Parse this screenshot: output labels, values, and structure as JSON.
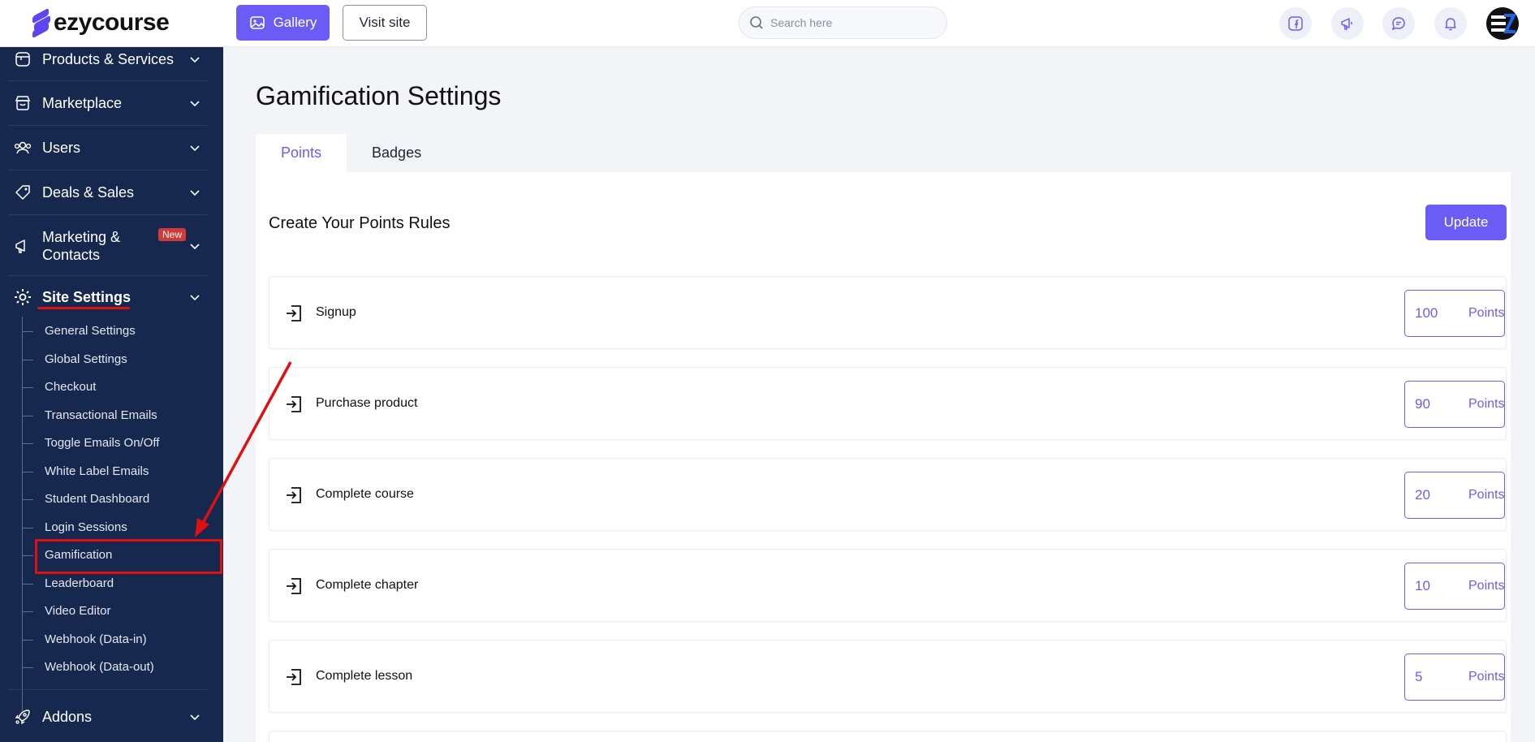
{
  "header": {
    "logo_text": "ezycourse",
    "gallery_label": "Gallery",
    "visit_site_label": "Visit site",
    "search_placeholder": "Search here"
  },
  "sidebar": {
    "items": [
      {
        "label": "Products & Services",
        "icon": "box-icon"
      },
      {
        "label": "Marketplace",
        "icon": "store-icon"
      },
      {
        "label": "Users",
        "icon": "users-icon"
      },
      {
        "label": "Deals & Sales",
        "icon": "tag-icon"
      },
      {
        "label_line1": "Marketing &",
        "label_line2": "Contacts",
        "badge": "New",
        "icon": "megaphone-icon"
      },
      {
        "label": "Site Settings",
        "icon": "gear-icon"
      },
      {
        "label": "Addons",
        "icon": "rocket-icon"
      }
    ],
    "site_settings_sub": [
      "General Settings",
      "Global Settings",
      "Checkout",
      "Transactional Emails",
      "Toggle Emails On/Off",
      "White Label Emails",
      "Student Dashboard",
      "Login Sessions",
      "Gamification",
      "Leaderboard",
      "Video Editor",
      "Webhook (Data-in)",
      "Webhook (Data-out)"
    ]
  },
  "main": {
    "title": "Gamification Settings",
    "tabs": [
      "Points",
      "Badges"
    ],
    "section_title": "Create Your Points Rules",
    "update_label": "Update",
    "points_unit": "Points",
    "rules": [
      {
        "label": "Signup",
        "points": "100"
      },
      {
        "label": "Purchase product",
        "points": "90"
      },
      {
        "label": "Complete course",
        "points": "20"
      },
      {
        "label": "Complete chapter",
        "points": "10"
      },
      {
        "label": "Complete lesson",
        "points": "5"
      }
    ]
  },
  "colors": {
    "accent": "#6b5cf6",
    "sidebar_bg": "#16284e",
    "annotation_red": "#e01010"
  }
}
